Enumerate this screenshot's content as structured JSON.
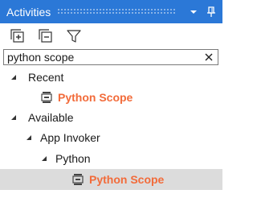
{
  "panel": {
    "title": "Activities",
    "title_buttons": [
      {
        "icon": "dropdown-arrow-icon"
      },
      {
        "icon": "pin-icon"
      }
    ]
  },
  "toolbar": {
    "buttons": [
      {
        "icon": "expand-all-icon"
      },
      {
        "icon": "collapse-all-icon"
      },
      {
        "icon": "filter-icon"
      }
    ]
  },
  "search": {
    "value": "python scope",
    "clear_icon": "close-icon"
  },
  "tree": {
    "recent": {
      "label": "Recent",
      "items": [
        {
          "label": "Python Scope",
          "icon": "scope-activity-icon"
        }
      ]
    },
    "available": {
      "label": "Available",
      "app_invoker": {
        "label": "App Invoker",
        "python": {
          "label": "Python",
          "items": [
            {
              "label": "Python Scope",
              "icon": "scope-activity-icon",
              "selected": true
            }
          ]
        }
      }
    }
  },
  "colors": {
    "title_bar": "#2b78d7",
    "activity_text": "#f26b3a",
    "selected_row": "#dcdcdc"
  }
}
